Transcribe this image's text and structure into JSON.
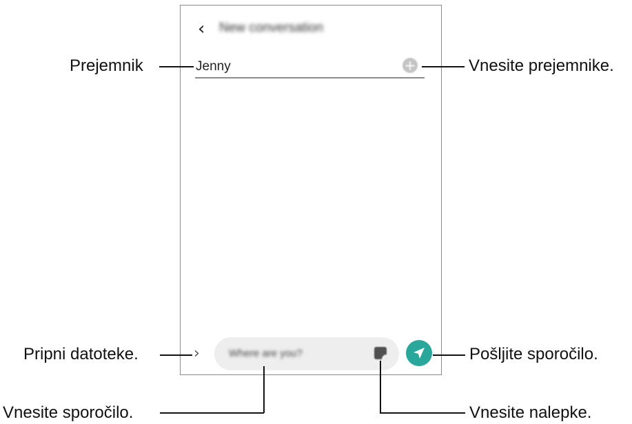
{
  "screen": {
    "back_glyph": "‹",
    "title": "New conversation",
    "recipient_value": "Jenny",
    "add_glyph": "+",
    "attach_glyph": "›",
    "message_placeholder": "Where are you?",
    "accent_color": "#2aa79b"
  },
  "callouts": {
    "recipient": "Prejemnik",
    "enter_recipients": "Vnesite prejemnike.",
    "attach_files": "Pripni datoteke.",
    "send_message": "Pošljite sporočilo.",
    "enter_message": "Vnesite sporočilo.",
    "enter_stickers": "Vnesite nalepke."
  },
  "icons": {
    "back": "chevron-left-icon",
    "add": "plus-circle-icon",
    "attach": "chevron-right-icon",
    "sticker": "sticker-icon",
    "send": "paper-plane-icon"
  }
}
